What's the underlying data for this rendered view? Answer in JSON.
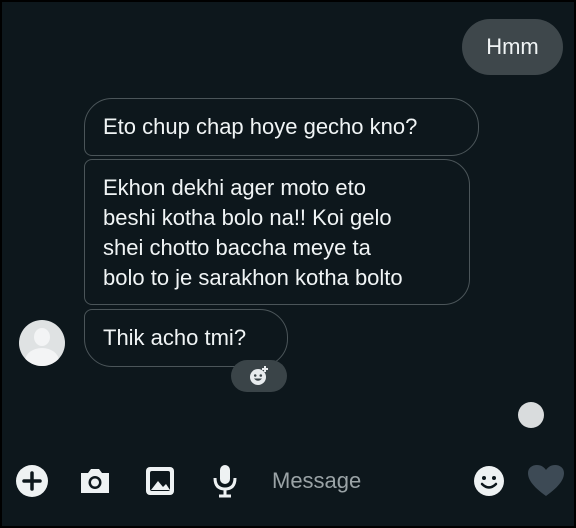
{
  "messages": {
    "sent": [
      {
        "text": "Hmm"
      }
    ],
    "received": [
      {
        "text": "Eto chup chap hoye gecho kno?"
      },
      {
        "lines": [
          "Ekhon dekhi ager moto eto",
          "beshi kotha bolo na!! Koi gelo",
          "shei chotto baccha meye ta",
          "bolo to je sarakhon kotha bolto"
        ]
      },
      {
        "text": "Thik acho tmi?"
      }
    ]
  },
  "composer": {
    "placeholder": "Message",
    "icons": [
      "plus-icon",
      "camera-icon",
      "gallery-icon",
      "microphone-icon",
      "emoji-icon",
      "heart-icon"
    ]
  },
  "colors": {
    "background": "#0d171c",
    "sent_bubble": "#3e474b",
    "received_border": "#4b5559",
    "text": "#f0f4f5",
    "placeholder": "#9aa3a6"
  }
}
